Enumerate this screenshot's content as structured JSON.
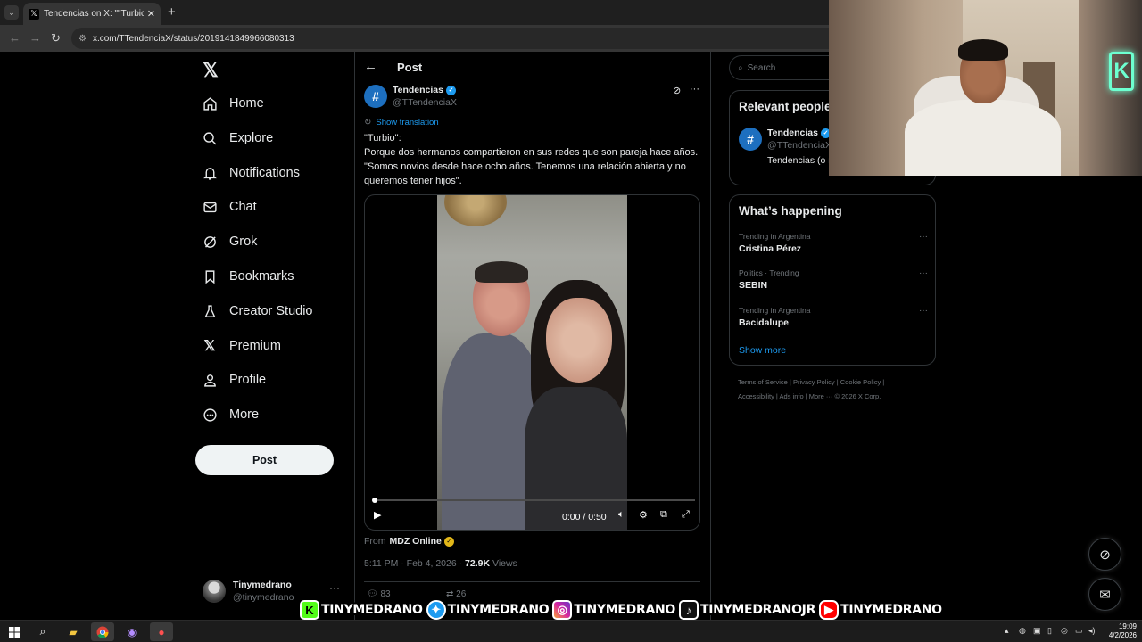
{
  "browser": {
    "tab_title": "Tendencias on X: \"\"Turbio\": Porq",
    "tab_close": "✕",
    "new_tab": "+",
    "url": "x.com/TTendenciaX/status/2019141849966080313"
  },
  "sidebar": {
    "items": [
      {
        "label": "Home",
        "icon": "home-icon"
      },
      {
        "label": "Explore",
        "icon": "search-icon"
      },
      {
        "label": "Notifications",
        "icon": "bell-icon"
      },
      {
        "label": "Chat",
        "icon": "mail-icon"
      },
      {
        "label": "Grok",
        "icon": "grok-icon"
      },
      {
        "label": "Bookmarks",
        "icon": "bookmark-icon"
      },
      {
        "label": "Creator Studio",
        "icon": "flask-icon"
      },
      {
        "label": "Premium",
        "icon": "x-icon"
      },
      {
        "label": "Profile",
        "icon": "person-icon"
      },
      {
        "label": "More",
        "icon": "more-circle-icon"
      }
    ],
    "post_button": "Post",
    "account": {
      "name": "Tinymedrano",
      "handle": "@tinymedrano"
    }
  },
  "header": {
    "title": "Post"
  },
  "post": {
    "author_name": "Tendencias",
    "author_handle": "@TTendenciaX",
    "show_translation": "Show translation",
    "text_lines": [
      "\"Turbio\":",
      "Porque dos hermanos compartieron en sus redes que son pareja hace años. \"Somos novios desde hace ocho años. Tenemos una relación abierta y no queremos tener hijos\"."
    ],
    "video": {
      "time": "0:00 / 0:50",
      "progress": 0.0
    },
    "from_label": "From",
    "from_source": "MDZ Online",
    "timestamp": "5:11 PM · Feb 4, 2026 ·",
    "views_count": "72.9K",
    "views_label": "Views",
    "stats": {
      "replies": "83",
      "reposts": "26"
    }
  },
  "right": {
    "search_placeholder": "Search",
    "relevant_title": "Relevant people",
    "relevant": {
      "name": "Tendencias",
      "handle": "@TTendenciaX",
      "bio": "Tendencias (o no). Parodia. Consu"
    },
    "happening_title": "What’s happening",
    "trends": [
      {
        "context": "Trending in Argentina",
        "title": "Cristina Pérez"
      },
      {
        "context": "Politics · Trending",
        "title": "SEBIN"
      },
      {
        "context": "Trending in Argentina",
        "title": "Bacidalupe"
      }
    ],
    "show_more": "Show more",
    "footer_line1": "Terms of Service  |  Privacy Policy  |  Cookie Policy  |",
    "footer_line2": "Accessibility  |  Ads info  |  More ···  © 2026 X Corp."
  },
  "banner": [
    {
      "platform": "kick",
      "handle": "TINYMEDRANO",
      "color": "#53fc18"
    },
    {
      "platform": "twitter",
      "handle": "TINYMEDRANO",
      "color": "#1d9bf0"
    },
    {
      "platform": "instagram",
      "handle": "TINYMEDRANO",
      "color": "#d6249f"
    },
    {
      "platform": "tiktok",
      "handle": "TINYMEDRANOJR",
      "color": "#111111"
    },
    {
      "platform": "youtube",
      "handle": "TINYMEDRANO",
      "color": "#ff0000"
    }
  ],
  "taskbar": {
    "time": "19:09",
    "date": "4/2/2026"
  }
}
